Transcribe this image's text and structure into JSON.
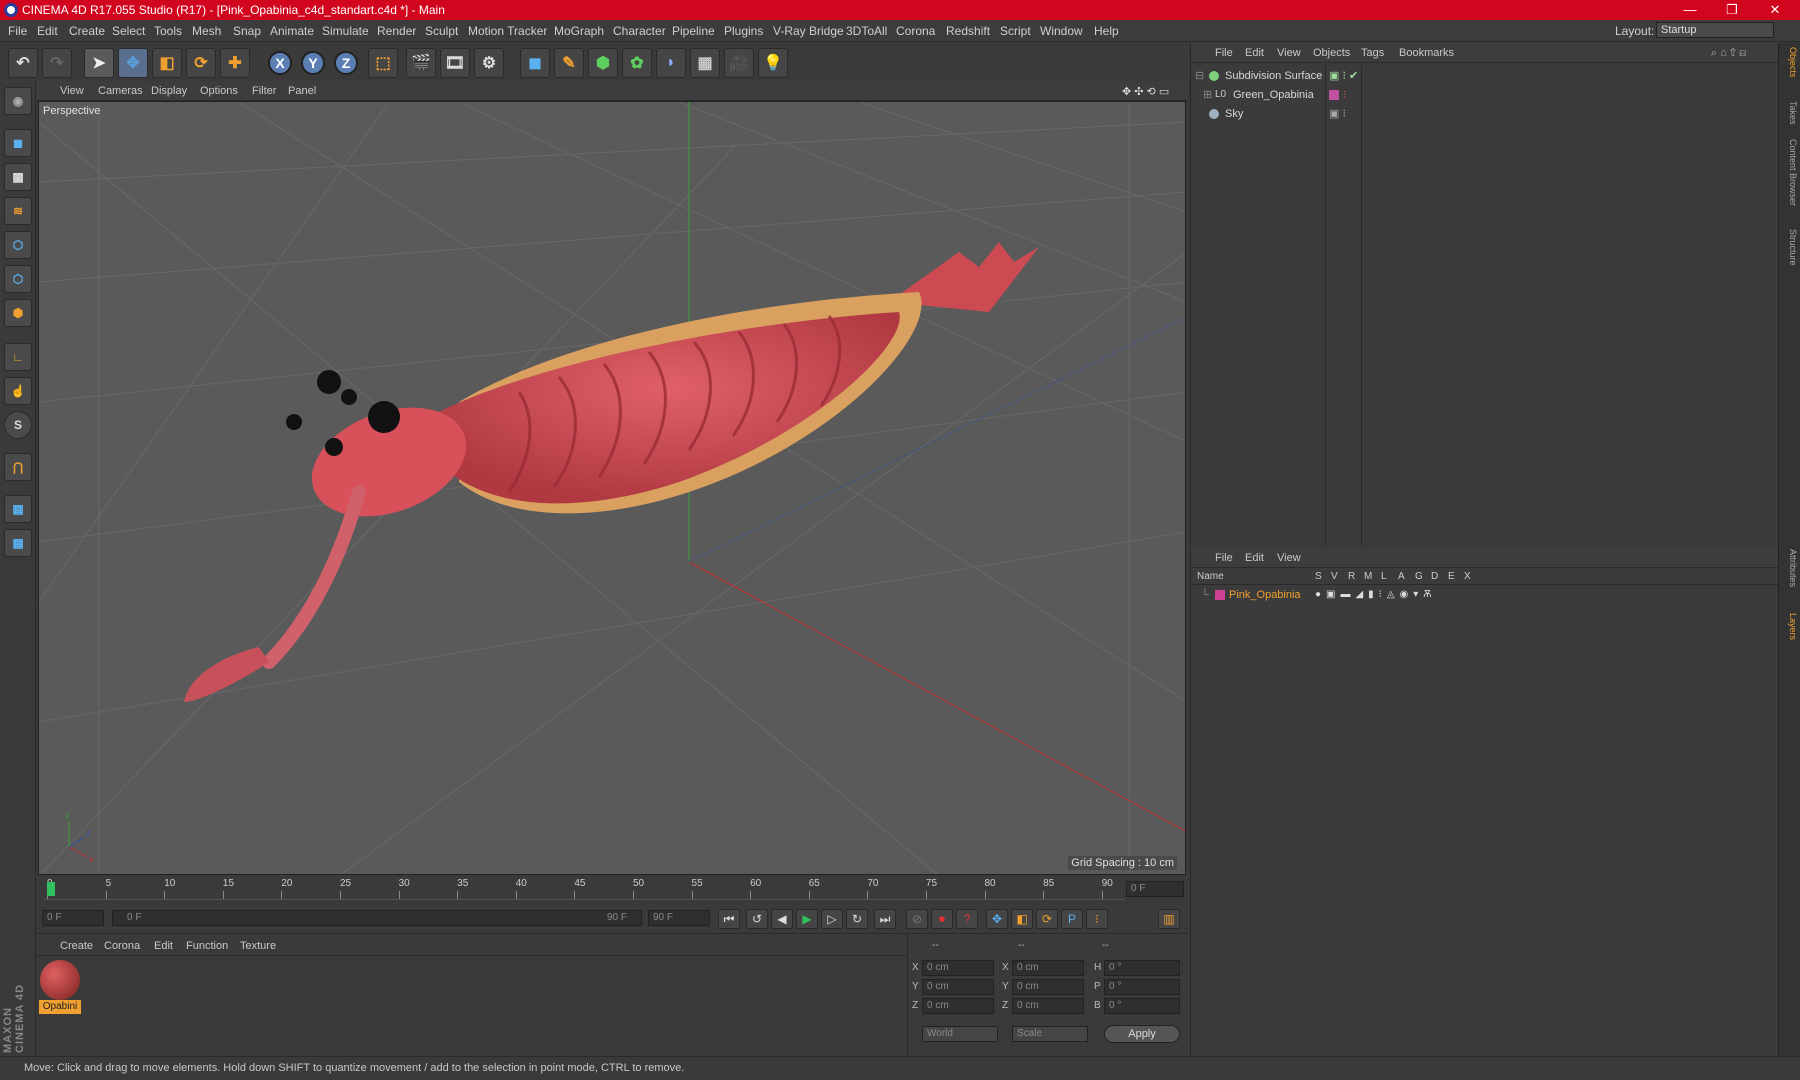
{
  "window": {
    "title": "CINEMA 4D R17.055 Studio (R17) - [Pink_Opabinia_c4d_standart.c4d *] - Main",
    "minimize": "—",
    "maximize": "❐",
    "close": "✕"
  },
  "menu": [
    "File",
    "Edit",
    "Create",
    "Select",
    "Tools",
    "Mesh",
    "Snap",
    "Animate",
    "Simulate",
    "Render",
    "Sculpt",
    "Motion Tracker",
    "MoGraph",
    "Character",
    "Pipeline",
    "Plugins",
    "V-Ray Bridge",
    "3DToAll",
    "Corona",
    "Redshift",
    "Script",
    "Window",
    "Help"
  ],
  "layout": {
    "label": "Layout:",
    "value": "Startup"
  },
  "toolbar": {
    "x": "X",
    "y": "Y",
    "z": "Z"
  },
  "viewport": {
    "menu": [
      "View",
      "Cameras",
      "Display",
      "Options",
      "Filter",
      "Panel"
    ],
    "label": "Perspective",
    "grid_spacing": "Grid Spacing : 10 cm",
    "axis_x": "x",
    "axis_y": "y",
    "axis_z": "z"
  },
  "timeline": {
    "ticks": [
      "0",
      "5",
      "10",
      "15",
      "20",
      "25",
      "30",
      "35",
      "40",
      "45",
      "50",
      "55",
      "60",
      "65",
      "70",
      "75",
      "80",
      "85",
      "90"
    ],
    "current_frame": "0 F"
  },
  "transport": {
    "start": "0 F",
    "range_start": "0 F",
    "range_end": "90 F",
    "end": "90 F"
  },
  "material_manager": {
    "menu": [
      "Create",
      "Corona",
      "Edit",
      "Function",
      "Texture"
    ],
    "material_name": "Opabini"
  },
  "coordinates": {
    "headers": [
      "--",
      "--",
      "--"
    ],
    "rows": [
      {
        "axis": "X",
        "pos": "0 cm",
        "axis2": "X",
        "size": "0 cm",
        "rot_label": "H",
        "rot": "0 °"
      },
      {
        "axis": "Y",
        "pos": "0 cm",
        "axis2": "Y",
        "size": "0 cm",
        "rot_label": "P",
        "rot": "0 °"
      },
      {
        "axis": "Z",
        "pos": "0 cm",
        "axis2": "Z",
        "size": "0 cm",
        "rot_label": "B",
        "rot": "0 °"
      }
    ],
    "mode1": "World",
    "mode2": "Scale",
    "apply": "Apply"
  },
  "status": "Move: Click and drag to move elements. Hold down SHIFT to quantize movement / add to the selection in point mode, CTRL to remove.",
  "objects_panel": {
    "menu": [
      "File",
      "Edit",
      "View",
      "Objects",
      "Tags",
      "Bookmarks"
    ],
    "items": [
      {
        "name": "Subdivision Surface",
        "color": "#7fcf7f"
      },
      {
        "name": "Green_Opabinia",
        "color": "#c050a0"
      },
      {
        "name": "Sky",
        "color": "#9fb0c0"
      }
    ]
  },
  "layers_panel": {
    "menu": [
      "File",
      "Edit",
      "View"
    ],
    "name_header": "Name",
    "cols": [
      "S",
      "V",
      "R",
      "M",
      "L",
      "A",
      "G",
      "D",
      "E",
      "X"
    ],
    "layer": {
      "name": "Pink_Opabinia",
      "color": "#d04090"
    }
  },
  "right_tabs": [
    "Objects",
    "Takes",
    "Content Browser",
    "Structure",
    "Attributes",
    "Layers"
  ],
  "brand": "MAXON CINEMA 4D",
  "colors": {
    "accent": "#d2051f",
    "active_item": "#f0a030",
    "axis_blue": "#5b7fb3"
  }
}
